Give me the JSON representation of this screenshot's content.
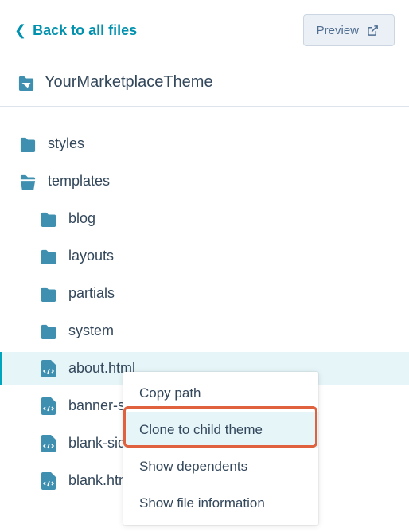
{
  "header": {
    "back_label": "Back to all files",
    "preview_label": "Preview"
  },
  "theme": {
    "name": "YourMarketplaceTheme"
  },
  "tree": {
    "root": [
      {
        "label": "styles",
        "type": "folder",
        "open": false
      },
      {
        "label": "templates",
        "type": "folder",
        "open": true
      }
    ],
    "templates_children": [
      {
        "label": "blog",
        "type": "folder"
      },
      {
        "label": "layouts",
        "type": "folder"
      },
      {
        "label": "partials",
        "type": "folder"
      },
      {
        "label": "system",
        "type": "folder"
      },
      {
        "label": "about.html",
        "type": "file",
        "selected": true
      },
      {
        "label": "banner-si",
        "type": "file"
      },
      {
        "label": "blank-sid",
        "type": "file"
      },
      {
        "label": "blank.htm",
        "type": "file"
      }
    ]
  },
  "context_menu": {
    "items": [
      {
        "label": "Copy path"
      },
      {
        "label": "Clone to child theme",
        "highlighted": true
      },
      {
        "label": "Show dependents"
      },
      {
        "label": "Show file information"
      }
    ]
  }
}
